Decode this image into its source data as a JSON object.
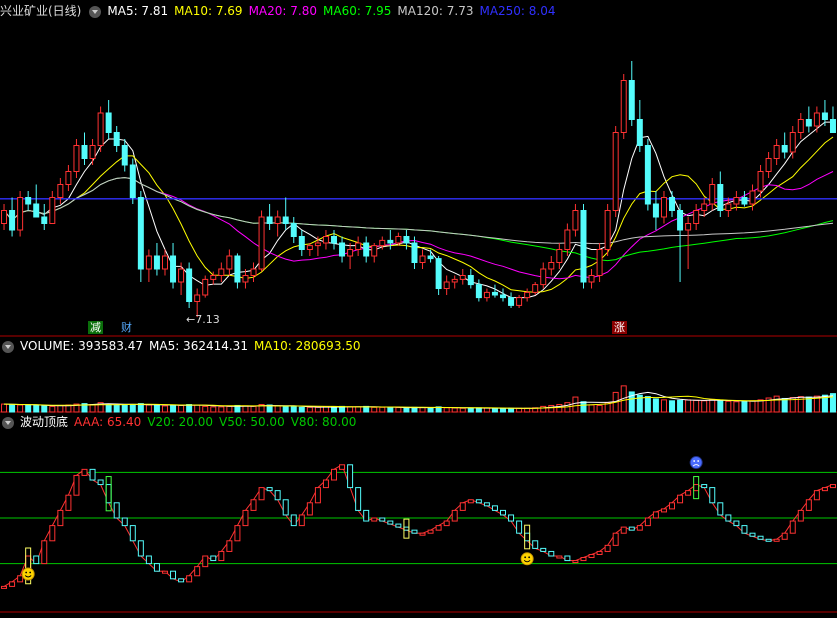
{
  "price_panel": {
    "title": "兴业矿业(日线)",
    "ma": [
      {
        "label": "MA5: 7.81",
        "color": "#ffffff"
      },
      {
        "label": "MA10: 7.69",
        "color": "#ffff00"
      },
      {
        "label": "MA20: 7.80",
        "color": "#ff00ff"
      },
      {
        "label": "MA60: 7.95",
        "color": "#00ff00"
      },
      {
        "label": "MA120: 7.73",
        "color": "#c8c8c8"
      },
      {
        "label": "MA250: 8.04",
        "color": "#3030ff"
      }
    ],
    "low_label": "←7.13",
    "badges": [
      {
        "text": "减",
        "bg": "#0a6e0a",
        "fg": "#ffffff"
      },
      {
        "text": "财",
        "bg": "#000000",
        "fg": "#55aaff"
      },
      {
        "text": "涨",
        "bg": "#8b0000",
        "fg": "#ffffff"
      }
    ]
  },
  "volume_panel": {
    "title": "VOLUME: 393583.47",
    "ma5": "MA5: 362414.31",
    "ma10": "MA10: 280693.50"
  },
  "indicator_panel": {
    "title": "波动顶底",
    "aaa": "AAA: 65.40",
    "v20": "V20: 20.00",
    "v50": "V50: 50.00",
    "v80": "V80: 80.00",
    "levels": [
      20,
      50,
      80
    ]
  },
  "colors": {
    "up": "#ff3232",
    "down": "#54fcfc",
    "ma5": "#ffffff",
    "ma10": "#ffff00",
    "ma20": "#ff00ff",
    "ma60": "#00ff00",
    "ma120": "#c8c8c8",
    "ma250": "#3030ff",
    "level": "#00c800",
    "panel_border": "#b00000"
  },
  "chart_data": {
    "type": "candlestick",
    "ylim": [
      7.0,
      9.4
    ],
    "low_marker": 7.13,
    "candles": [
      [
        7.85,
        8.0,
        7.8,
        7.95
      ],
      [
        7.95,
        8.05,
        7.75,
        7.8
      ],
      [
        7.8,
        8.1,
        7.75,
        8.05
      ],
      [
        8.05,
        8.1,
        7.95,
        8.0
      ],
      [
        8.0,
        8.15,
        7.95,
        7.9
      ],
      [
        7.9,
        8.0,
        7.8,
        7.85
      ],
      [
        7.85,
        8.1,
        7.85,
        8.05
      ],
      [
        8.05,
        8.2,
        8.0,
        8.15
      ],
      [
        8.15,
        8.3,
        8.1,
        8.25
      ],
      [
        8.25,
        8.5,
        8.2,
        8.45
      ],
      [
        8.45,
        8.55,
        8.3,
        8.35
      ],
      [
        8.35,
        8.5,
        8.3,
        8.45
      ],
      [
        8.45,
        8.75,
        8.4,
        8.7
      ],
      [
        8.7,
        8.8,
        8.5,
        8.55
      ],
      [
        8.55,
        8.6,
        8.4,
        8.45
      ],
      [
        8.45,
        8.5,
        8.25,
        8.3
      ],
      [
        8.3,
        8.35,
        8.0,
        8.05
      ],
      [
        8.05,
        8.1,
        7.4,
        7.5
      ],
      [
        7.5,
        7.65,
        7.4,
        7.6
      ],
      [
        7.6,
        7.7,
        7.45,
        7.5
      ],
      [
        7.5,
        7.65,
        7.45,
        7.6
      ],
      [
        7.6,
        7.7,
        7.35,
        7.4
      ],
      [
        7.4,
        7.55,
        7.3,
        7.5
      ],
      [
        7.5,
        7.55,
        7.2,
        7.25
      ],
      [
        7.25,
        7.35,
        7.13,
        7.3
      ],
      [
        7.3,
        7.45,
        7.28,
        7.42
      ],
      [
        7.42,
        7.48,
        7.38,
        7.45
      ],
      [
        7.45,
        7.55,
        7.4,
        7.5
      ],
      [
        7.5,
        7.65,
        7.45,
        7.6
      ],
      [
        7.6,
        7.62,
        7.35,
        7.4
      ],
      [
        7.4,
        7.5,
        7.35,
        7.45
      ],
      [
        7.45,
        7.55,
        7.4,
        7.5
      ],
      [
        7.5,
        7.95,
        7.48,
        7.9
      ],
      [
        7.9,
        8.0,
        7.8,
        7.85
      ],
      [
        7.85,
        7.95,
        7.75,
        7.9
      ],
      [
        7.9,
        8.05,
        7.8,
        7.85
      ],
      [
        7.85,
        7.9,
        7.7,
        7.75
      ],
      [
        7.75,
        7.8,
        7.6,
        7.65
      ],
      [
        7.65,
        7.7,
        7.6,
        7.68
      ],
      [
        7.68,
        7.75,
        7.6,
        7.7
      ],
      [
        7.7,
        7.8,
        7.65,
        7.75
      ],
      [
        7.75,
        7.8,
        7.65,
        7.7
      ],
      [
        7.7,
        7.75,
        7.55,
        7.6
      ],
      [
        7.6,
        7.7,
        7.5,
        7.65
      ],
      [
        7.65,
        7.75,
        7.6,
        7.7
      ],
      [
        7.7,
        7.75,
        7.55,
        7.6
      ],
      [
        7.6,
        7.7,
        7.55,
        7.68
      ],
      [
        7.68,
        7.75,
        7.65,
        7.72
      ],
      [
        7.72,
        7.8,
        7.65,
        7.7
      ],
      [
        7.7,
        7.78,
        7.68,
        7.75
      ],
      [
        7.75,
        7.8,
        7.65,
        7.7
      ],
      [
        7.7,
        7.75,
        7.5,
        7.55
      ],
      [
        7.55,
        7.65,
        7.5,
        7.6
      ],
      [
        7.6,
        7.65,
        7.55,
        7.58
      ],
      [
        7.58,
        7.6,
        7.3,
        7.35
      ],
      [
        7.35,
        7.45,
        7.3,
        7.4
      ],
      [
        7.4,
        7.45,
        7.35,
        7.42
      ],
      [
        7.42,
        7.5,
        7.38,
        7.45
      ],
      [
        7.45,
        7.5,
        7.35,
        7.38
      ],
      [
        7.38,
        7.42,
        7.25,
        7.28
      ],
      [
        7.28,
        7.35,
        7.25,
        7.32
      ],
      [
        7.32,
        7.38,
        7.28,
        7.3
      ],
      [
        7.3,
        7.35,
        7.25,
        7.28
      ],
      [
        7.28,
        7.32,
        7.2,
        7.22
      ],
      [
        7.22,
        7.3,
        7.2,
        7.28
      ],
      [
        7.28,
        7.35,
        7.25,
        7.32
      ],
      [
        7.32,
        7.4,
        7.3,
        7.38
      ],
      [
        7.38,
        7.55,
        7.35,
        7.5
      ],
      [
        7.5,
        7.6,
        7.45,
        7.55
      ],
      [
        7.55,
        7.7,
        7.5,
        7.65
      ],
      [
        7.65,
        7.85,
        7.6,
        7.8
      ],
      [
        7.8,
        8.0,
        7.75,
        7.95
      ],
      [
        7.95,
        8.0,
        7.35,
        7.4
      ],
      [
        7.4,
        7.5,
        7.35,
        7.45
      ],
      [
        7.45,
        7.7,
        7.4,
        7.65
      ],
      [
        7.65,
        8.0,
        7.6,
        7.95
      ],
      [
        7.95,
        8.6,
        7.9,
        8.55
      ],
      [
        8.55,
        9.0,
        8.5,
        8.95
      ],
      [
        8.95,
        9.1,
        8.6,
        8.65
      ],
      [
        8.65,
        8.8,
        8.4,
        8.45
      ],
      [
        8.45,
        8.5,
        7.95,
        8.0
      ],
      [
        8.0,
        8.1,
        7.8,
        7.9
      ],
      [
        7.9,
        8.1,
        7.85,
        8.05
      ],
      [
        8.05,
        8.1,
        7.9,
        7.95
      ],
      [
        7.95,
        8.0,
        7.4,
        7.8
      ],
      [
        7.8,
        7.9,
        7.5,
        7.85
      ],
      [
        7.85,
        8.0,
        7.8,
        7.95
      ],
      [
        7.95,
        8.05,
        7.9,
        8.0
      ],
      [
        8.0,
        8.2,
        7.95,
        8.15
      ],
      [
        8.15,
        8.25,
        7.9,
        7.95
      ],
      [
        7.95,
        8.05,
        7.9,
        8.0
      ],
      [
        8.0,
        8.1,
        7.95,
        8.05
      ],
      [
        8.05,
        8.1,
        7.98,
        8.0
      ],
      [
        8.0,
        8.15,
        7.95,
        8.1
      ],
      [
        8.1,
        8.3,
        8.05,
        8.25
      ],
      [
        8.25,
        8.4,
        8.2,
        8.35
      ],
      [
        8.35,
        8.5,
        8.3,
        8.45
      ],
      [
        8.45,
        8.55,
        8.35,
        8.4
      ],
      [
        8.4,
        8.6,
        8.35,
        8.55
      ],
      [
        8.55,
        8.7,
        8.5,
        8.65
      ],
      [
        8.65,
        8.75,
        8.55,
        8.6
      ],
      [
        8.6,
        8.75,
        8.55,
        8.7
      ],
      [
        8.7,
        8.8,
        8.6,
        8.65
      ],
      [
        8.65,
        8.75,
        8.55,
        8.55
      ]
    ],
    "volume_ylim": [
      0,
      1200000
    ],
    "volume": [
      170000,
      160000,
      150000,
      150000,
      140000,
      130000,
      120000,
      140000,
      150000,
      170000,
      180000,
      160000,
      200000,
      170000,
      150000,
      140000,
      160000,
      180000,
      150000,
      140000,
      130000,
      150000,
      140000,
      160000,
      150000,
      120000,
      110000,
      110000,
      120000,
      140000,
      130000,
      120000,
      160000,
      150000,
      130000,
      120000,
      110000,
      100000,
      100000,
      100000,
      110000,
      110000,
      120000,
      110000,
      110000,
      120000,
      100000,
      100000,
      90000,
      95000,
      90000,
      100000,
      95000,
      90000,
      110000,
      90000,
      85000,
      80000,
      80000,
      90000,
      85000,
      80000,
      75000,
      70000,
      80000,
      80000,
      90000,
      120000,
      140000,
      160000,
      200000,
      320000,
      220000,
      150000,
      140000,
      200000,
      420000,
      560000,
      430000,
      360000,
      330000,
      280000,
      260000,
      240000,
      250000,
      260000,
      250000,
      240000,
      270000,
      240000,
      230000,
      220000,
      230000,
      240000,
      260000,
      300000,
      340000,
      290000,
      310000,
      330000,
      320000,
      340000,
      360000,
      393583
    ],
    "indicator_ylim": [
      0,
      100
    ],
    "indicator": [
      5,
      8,
      12,
      25,
      20,
      35,
      45,
      55,
      65,
      78,
      82,
      75,
      72,
      60,
      50,
      45,
      35,
      25,
      20,
      15,
      15,
      10,
      8,
      12,
      18,
      25,
      22,
      28,
      35,
      45,
      55,
      62,
      70,
      68,
      62,
      52,
      45,
      52,
      60,
      70,
      75,
      82,
      85,
      70,
      55,
      48,
      50,
      48,
      46,
      44,
      42,
      40,
      40,
      42,
      45,
      48,
      55,
      60,
      62,
      60,
      58,
      55,
      52,
      48,
      40,
      35,
      30,
      28,
      25,
      25,
      22,
      22,
      24,
      26,
      28,
      32,
      40,
      44,
      42,
      45,
      50,
      54,
      56,
      60,
      65,
      68,
      72,
      70,
      60,
      52,
      48,
      45,
      40,
      38,
      36,
      35,
      36,
      40,
      48,
      55,
      62,
      68,
      70,
      72
    ],
    "indicator_marks": [
      3,
      13,
      50,
      65,
      86
    ],
    "smiley_bottom": [
      3,
      65
    ],
    "smiley_top": [
      86
    ]
  }
}
